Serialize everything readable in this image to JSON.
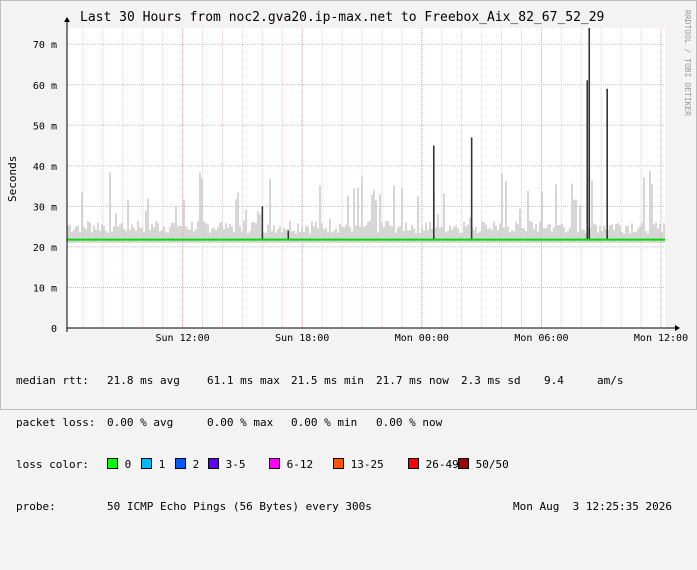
{
  "title": "Last 30 Hours from noc2.gva20.ip-max.net to Freebox_Aix_82_67_52_29",
  "side_credit": "RRDTOOL / TOBI OETIKER",
  "chart_data": {
    "type": "line",
    "ylabel": "Seconds",
    "y_ticks": [
      "0",
      "10 m",
      "20 m",
      "30 m",
      "40 m",
      "50 m",
      "60 m",
      "70 m"
    ],
    "y_tick_values": [
      0,
      0.01,
      0.02,
      0.03,
      0.04,
      0.05,
      0.06,
      0.07
    ],
    "ylim": [
      0,
      0.074
    ],
    "x_ticks": [
      "Sun 12:00",
      "Sun 18:00",
      "Mon 00:00",
      "Mon 06:00",
      "Mon 12:00"
    ],
    "x_tick_hours": [
      5.8,
      11.8,
      17.8,
      23.8,
      29.8
    ],
    "xlim_hours": [
      0,
      30
    ],
    "grid": true,
    "median_rtt_ms": 21.8,
    "median_line_color": "#00dd00",
    "smoke_color": "#c8c8c8",
    "dark_spike_color": "#333333",
    "spikes": [
      {
        "hour": 18.4,
        "max_ms": 45,
        "dark": true
      },
      {
        "hour": 20.3,
        "max_ms": 47,
        "dark": true
      },
      {
        "hour": 26.1,
        "max_ms": 61.1,
        "dark": true
      },
      {
        "hour": 26.2,
        "max_ms": 74,
        "dark": true
      },
      {
        "hour": 27.1,
        "max_ms": 59,
        "dark": true
      },
      {
        "hour": 9.8,
        "max_ms": 30,
        "dark": true
      },
      {
        "hour": 11.1,
        "max_ms": 24,
        "dark": true
      }
    ]
  },
  "stats": {
    "median_rtt": {
      "label": "median rtt:",
      "avg": "21.8 ms avg",
      "max": "61.1 ms max",
      "min": "21.5 ms min",
      "now": "21.7 ms now",
      "sd": "2.3 ms sd",
      "am": "9.4",
      "am_unit": "am/s"
    },
    "packet_loss": {
      "label": "packet loss:",
      "avg": "0.00 % avg",
      "max": "0.00 % max",
      "min": "0.00 % min",
      "now": "0.00 % now"
    },
    "loss_color": {
      "label": "loss color:",
      "items": [
        {
          "label": "0",
          "color": "#00ff00"
        },
        {
          "label": "1",
          "color": "#00b8ff"
        },
        {
          "label": "2",
          "color": "#0059ff"
        },
        {
          "label": "3-5",
          "color": "#5e00ff"
        },
        {
          "label": "6-12",
          "color": "#ff00ff"
        },
        {
          "label": "13-25",
          "color": "#ff5500"
        },
        {
          "label": "26-49",
          "color": "#ff0000"
        },
        {
          "label": "50/50",
          "color": "#a00000"
        }
      ]
    },
    "probe": {
      "label": "probe:",
      "desc": "50 ICMP Echo Pings (56 Bytes) every 300s",
      "date": "Mon Aug  3 12:25:35 2026"
    }
  }
}
